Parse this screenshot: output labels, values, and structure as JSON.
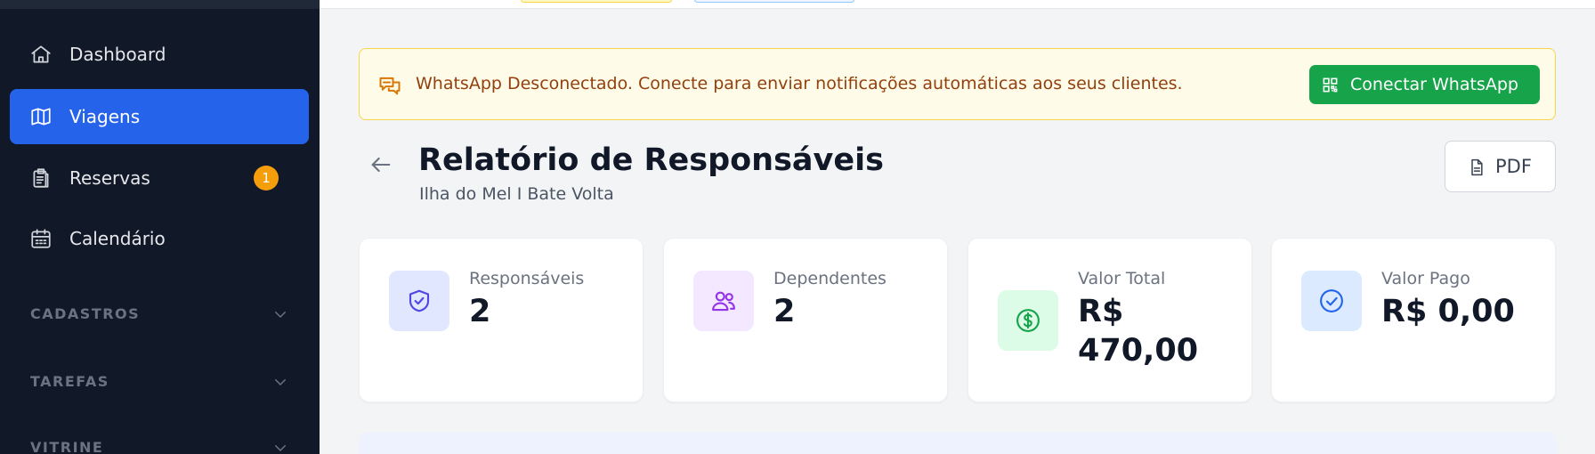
{
  "sidebar": {
    "items": [
      {
        "label": "Dashboard",
        "icon": "home-icon"
      },
      {
        "label": "Viagens",
        "icon": "map-icon",
        "active": true
      },
      {
        "label": "Reservas",
        "icon": "clipboard-icon",
        "badge": "1"
      },
      {
        "label": "Calendário",
        "icon": "calendar-icon"
      }
    ],
    "sections": [
      {
        "label": "CADASTROS"
      },
      {
        "label": "TAREFAS"
      },
      {
        "label": "VITRINE"
      }
    ]
  },
  "alert": {
    "message": "WhatsApp Desconectado. Conecte para enviar notificações automáticas aos seus clientes.",
    "button_label": "Conectar WhatsApp"
  },
  "header": {
    "title": "Relatório de Responsáveis",
    "subtitle": "Ilha do Mel I Bate Volta",
    "pdf_label": "PDF"
  },
  "stats": [
    {
      "label": "Responsáveis",
      "value": "2",
      "icon": "shield-check-icon",
      "color": "#4f46e5",
      "bg": "#e0e7ff"
    },
    {
      "label": "Dependentes",
      "value": "2",
      "icon": "users-icon",
      "color": "#9333ea",
      "bg": "#f3e8ff"
    },
    {
      "label": "Valor Total",
      "value": "R$ 470,00",
      "icon": "dollar-circle-icon",
      "color": "#16a34a",
      "bg": "#dcfce7"
    },
    {
      "label": "Valor Pago",
      "value": "R$ 0,00",
      "icon": "check-circle-icon",
      "color": "#2563eb",
      "bg": "#dbeafe"
    }
  ],
  "colors": {
    "sidebar_bg": "#111827",
    "active": "#2563eb",
    "badge": "#f59e0b",
    "whatsapp": "#16a34a",
    "alert_text": "#92400e"
  }
}
